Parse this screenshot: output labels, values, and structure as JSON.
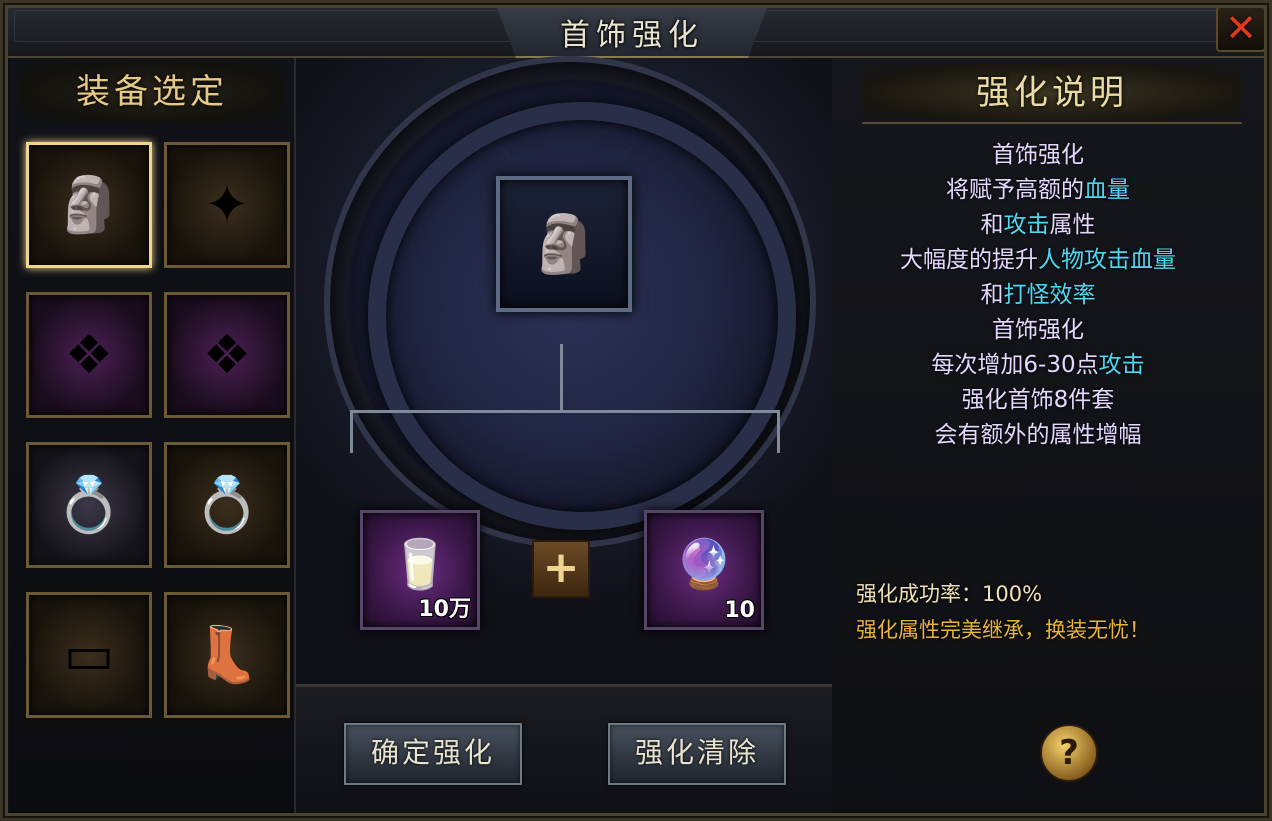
{
  "window": {
    "title": "首饰强化"
  },
  "left_panel": {
    "header": "装备选定",
    "slots": [
      {
        "icon": "golden-mask-icon",
        "selected": true
      },
      {
        "icon": "golden-amulet-icon",
        "selected": false
      },
      {
        "icon": "purple-bracelet-icon",
        "selected": false
      },
      {
        "icon": "purple-bracelet-icon",
        "selected": false
      },
      {
        "icon": "silver-ring-icon",
        "selected": false
      },
      {
        "icon": "gold-ring-icon",
        "selected": false
      },
      {
        "icon": "gold-belt-icon",
        "selected": false
      },
      {
        "icon": "gold-boots-icon",
        "selected": false
      }
    ]
  },
  "center": {
    "center_slot_icon": "golden-mask-icon",
    "material_1": {
      "icon": "silver-ingot-icon",
      "count": "10万"
    },
    "material_2": {
      "icon": "enhance-stone-icon",
      "count": "10"
    },
    "plus_label": "+",
    "confirm_label": "确定强化",
    "clear_label": "强化清除"
  },
  "right_panel": {
    "header": "强化说明",
    "lines": [
      {
        "parts": [
          {
            "text": "首饰强化",
            "hl": false
          }
        ]
      },
      {
        "parts": [
          {
            "text": "将赋予高额的",
            "hl": false
          },
          {
            "text": "血量",
            "hl": true
          }
        ]
      },
      {
        "parts": [
          {
            "text": "和",
            "hl": false
          },
          {
            "text": "攻击",
            "hl": true
          },
          {
            "text": "属性",
            "hl": false
          }
        ]
      },
      {
        "parts": [
          {
            "text": "大幅度的提升",
            "hl": false
          },
          {
            "text": "人物攻击血量",
            "hl": true
          }
        ]
      },
      {
        "parts": [
          {
            "text": "和",
            "hl": false
          },
          {
            "text": "打怪效率",
            "hl": true
          }
        ]
      },
      {
        "parts": [
          {
            "text": "首饰强化",
            "hl": false
          }
        ]
      },
      {
        "parts": [
          {
            "text": "每次增加6-30点",
            "hl": false
          },
          {
            "text": "攻击",
            "hl": true
          }
        ]
      },
      {
        "parts": [
          {
            "text": "强化首饰8件套",
            "hl": false
          }
        ]
      },
      {
        "parts": [
          {
            "text": "会有额外的属性增幅",
            "hl": false
          }
        ]
      }
    ],
    "success_rate": "强化成功率：100%",
    "note": "强化属性完美继承，换装无忧！",
    "help_label": "?"
  },
  "colors": {
    "highlight": "#4fd8f2",
    "text": "#e4d8ff",
    "gold_text": "#e9b53a",
    "header_text": "#eadca4",
    "close_red": "#e03a1c"
  }
}
